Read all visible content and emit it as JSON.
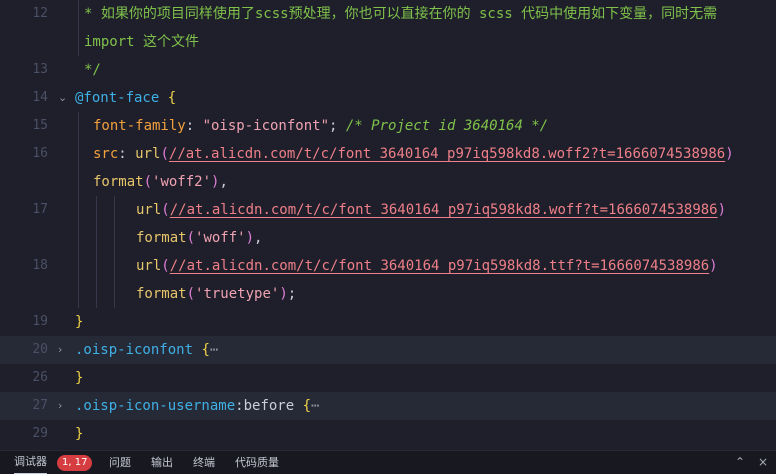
{
  "line_numbers": [
    "12",
    "13",
    "14",
    "15",
    "16",
    "17",
    "18",
    "19",
    "20",
    "26",
    "27",
    "29"
  ],
  "comment": {
    "line1": "* 如果你的项目同样使用了scss预处理，你也可以直接在你的 scss 代码中使用如下变量，同时无需",
    "line2": "import 这个文件",
    "close": "*/"
  },
  "font_face": {
    "at_rule": "@font-face",
    "open_brace": "{",
    "close_brace": "}",
    "family_prop": "font-family",
    "family_value": "\"oisp-iconfont\"",
    "family_comment": "/* Project id 3640164 */",
    "src_prop": "src",
    "url_fn": "url",
    "format_fn": "format",
    "url_woff2": "//at.alicdn.com/t/c/font_3640164_p97iq598kd8.woff2?t=1666074538986",
    "url_woff": "//at.alicdn.com/t/c/font_3640164_p97iq598kd8.woff?t=1666074538986",
    "url_ttf": "//at.alicdn.com/t/c/font_3640164_p97iq598kd8.ttf?t=1666074538986",
    "fmt_woff2": "'woff2'",
    "fmt_woff": "'woff'",
    "fmt_truetype": "'truetype'"
  },
  "rules": {
    "iconfont_selector": ".oisp-iconfont",
    "username_selector": ".oisp-icon-username",
    "username_pseudo": ":before",
    "open_brace": "{",
    "close_brace": "}",
    "ellipsis": "⋯"
  },
  "fold_icons": {
    "expanded": "chevron-down-icon",
    "collapsed": "chevron-right-icon"
  },
  "status_bar": {
    "tabs": [
      "调试器",
      "问题",
      "输出",
      "终端",
      "代码质量"
    ],
    "badge": "1, 17",
    "active_tab": "调试器"
  },
  "colors": {
    "background": "#1e1f2a",
    "comment": "#7fc14a",
    "keyword": "#3fb0e6",
    "property": "#f2a03d",
    "string": "#f0a2b2",
    "url": "#ef7f88",
    "function": "#e6c56b",
    "brace": "#f0d24a",
    "paren": "#e07ed7",
    "badge": "#d63d40"
  }
}
